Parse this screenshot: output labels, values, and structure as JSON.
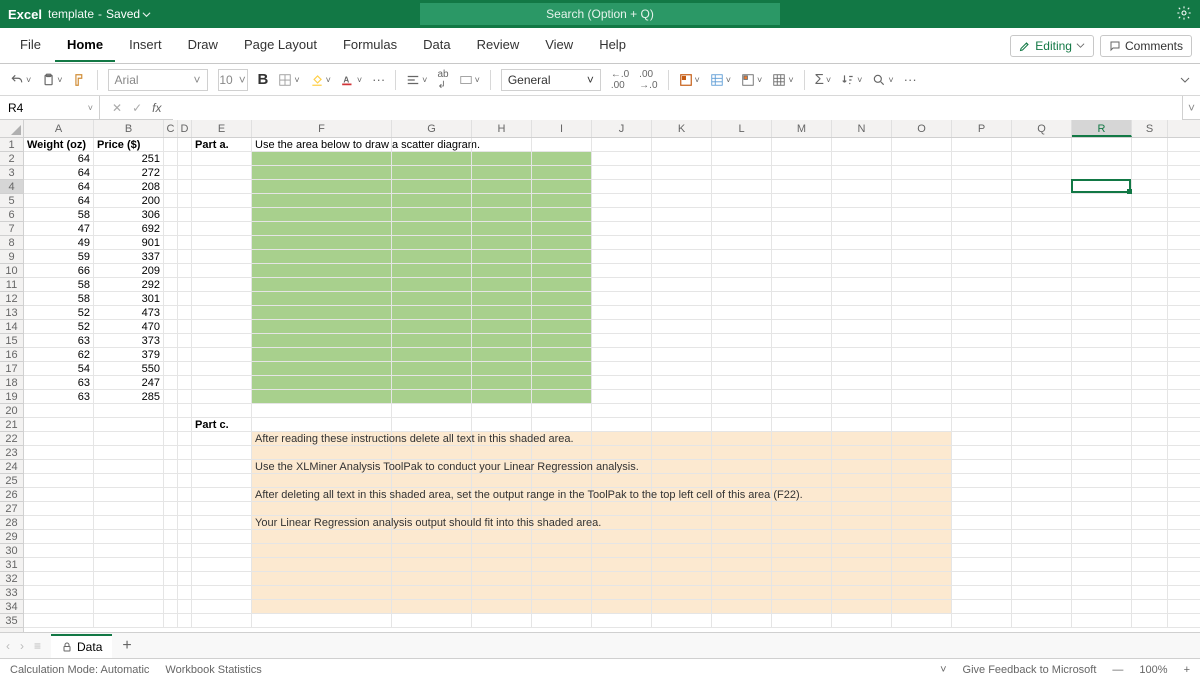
{
  "title": {
    "app": "Excel",
    "file": "template",
    "state": "Saved"
  },
  "search": {
    "placeholder": "Search (Option + Q)"
  },
  "tabs": [
    "File",
    "Home",
    "Insert",
    "Draw",
    "Page Layout",
    "Formulas",
    "Data",
    "Review",
    "View",
    "Help"
  ],
  "active_tab": "Home",
  "editing_btn": "Editing",
  "comments_btn": "Comments",
  "toolbar": {
    "font": "Arial",
    "size": "10",
    "bold": "B",
    "numfmt": "General"
  },
  "namebox": "R4",
  "columns": [
    "A",
    "B",
    "C",
    "D",
    "E",
    "F",
    "G",
    "H",
    "I",
    "J",
    "K",
    "L",
    "M",
    "N",
    "O",
    "P",
    "Q",
    "R",
    "S"
  ],
  "row_count": 35,
  "selected_col": "R",
  "selected_row": 4,
  "headers": {
    "A": "Weight (oz)",
    "B": "Price ($)",
    "E": "Part a.",
    "F": "Use the area below to draw a scatter diagram."
  },
  "part_c_label": "Part c.",
  "data_rows": [
    {
      "w": 64,
      "p": 251
    },
    {
      "w": 64,
      "p": 272
    },
    {
      "w": 64,
      "p": 208
    },
    {
      "w": 64,
      "p": 200
    },
    {
      "w": 58,
      "p": 306
    },
    {
      "w": 47,
      "p": 692
    },
    {
      "w": 49,
      "p": 901
    },
    {
      "w": 59,
      "p": 337
    },
    {
      "w": 66,
      "p": 209
    },
    {
      "w": 58,
      "p": 292
    },
    {
      "w": 58,
      "p": 301
    },
    {
      "w": 52,
      "p": 473
    },
    {
      "w": 52,
      "p": 470
    },
    {
      "w": 63,
      "p": 373
    },
    {
      "w": 62,
      "p": 379
    },
    {
      "w": 54,
      "p": 550
    },
    {
      "w": 63,
      "p": 247
    },
    {
      "w": 63,
      "p": 285
    }
  ],
  "instructions": {
    "l1": "After reading these instructions delete all text in this shaded area.",
    "l2": "Use the XLMiner Analysis ToolPak to conduct your Linear Regression analysis.",
    "l3": "After deleting all text in this shaded area, set the output range in the ToolPak to the top left cell of this area (F22).",
    "l4": "Your Linear Regression analysis output should fit into this shaded area."
  },
  "sheet": {
    "name": "Data"
  },
  "status": {
    "calc": "Calculation Mode: Automatic",
    "stats": "Workbook Statistics",
    "feedback": "Give Feedback to Microsoft",
    "zoom": "100%"
  }
}
